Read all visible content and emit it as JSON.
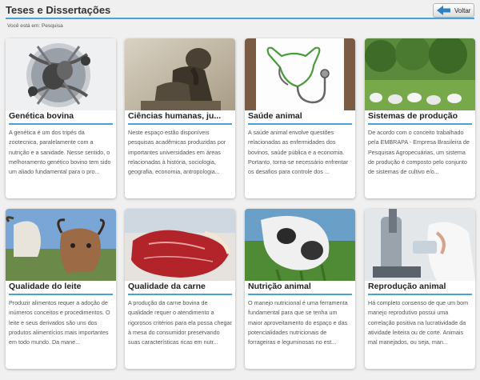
{
  "header": {
    "title": "Teses e Dissertações",
    "back_label": "Voltar",
    "breadcrumb": "Você está em: Pesquisa",
    "accent_color": "#4aa3d8"
  },
  "cards": [
    {
      "title": "Genética bovina",
      "image": "dna-cattle-image",
      "desc": "A genética é um dos tripés da zootecnica, paralelamente com a nutrição e a sanidade. Nesse sentido, o melhoramento genético bovino tem sido um aliado fundamental para o pro..."
    },
    {
      "title": "Ciências humanas, ju...",
      "image": "thinker-statue-image",
      "desc": "Neste espaço estão disponíveis pesquisas acadêmicas produzidas por importantes universidades em áreas relacionadas à história, sociologia, geografia, economia, antropologia..."
    },
    {
      "title": "Saúde animal",
      "image": "stethoscope-cow-image",
      "desc": "A saúde animal envolve questões relacionadas as enfermidades dos bovinos, saúde pública e a economia. Portanto, torna-se necessário enfrentar os desafios para controle dos ..."
    },
    {
      "title": "Sistemas de produção",
      "image": "cattle-pasture-image",
      "desc": "De acordo com o conceito trabalhado pela EMBRAPA - Empresa Brasileira de Pesquisas Agropecuárias, um sistema de produção é composto pelo conjunto de sistemas de cultivo e/o..."
    },
    {
      "title": "Qualidade do leite",
      "image": "dairy-cattle-image",
      "desc": "Produzir alimentos requer a adoção de inúmeros conceitos e procedimentos. O leite e seus derivados são uns dos produtos alimentícios mais importantes em todo mundo. Da mane..."
    },
    {
      "title": "Qualidade da carne",
      "image": "raw-beef-image",
      "desc": "A produção da carne bovina de qualidade requer o atendimento a rigorosos critérios para ela possa chegar à mesa do consumidor preservando suas características ricas em nutr..."
    },
    {
      "title": "Nutrição animal",
      "image": "cow-eating-grass-image",
      "desc": "O manejo nutricional é uma ferramenta fundamental para que se tenha um maior aproveitamento do espaço e das potencialidades nutricionais de forrageiras e leguminosas no est..."
    },
    {
      "title": "Reprodução animal",
      "image": "lab-microscope-image",
      "desc": "Há completo consenso de que um bom manejo reprodutivo possui uma correlação positiva na lucratividade da atividade leiteira ou de corte. Animais mal manejados, ou seja, man..."
    }
  ]
}
